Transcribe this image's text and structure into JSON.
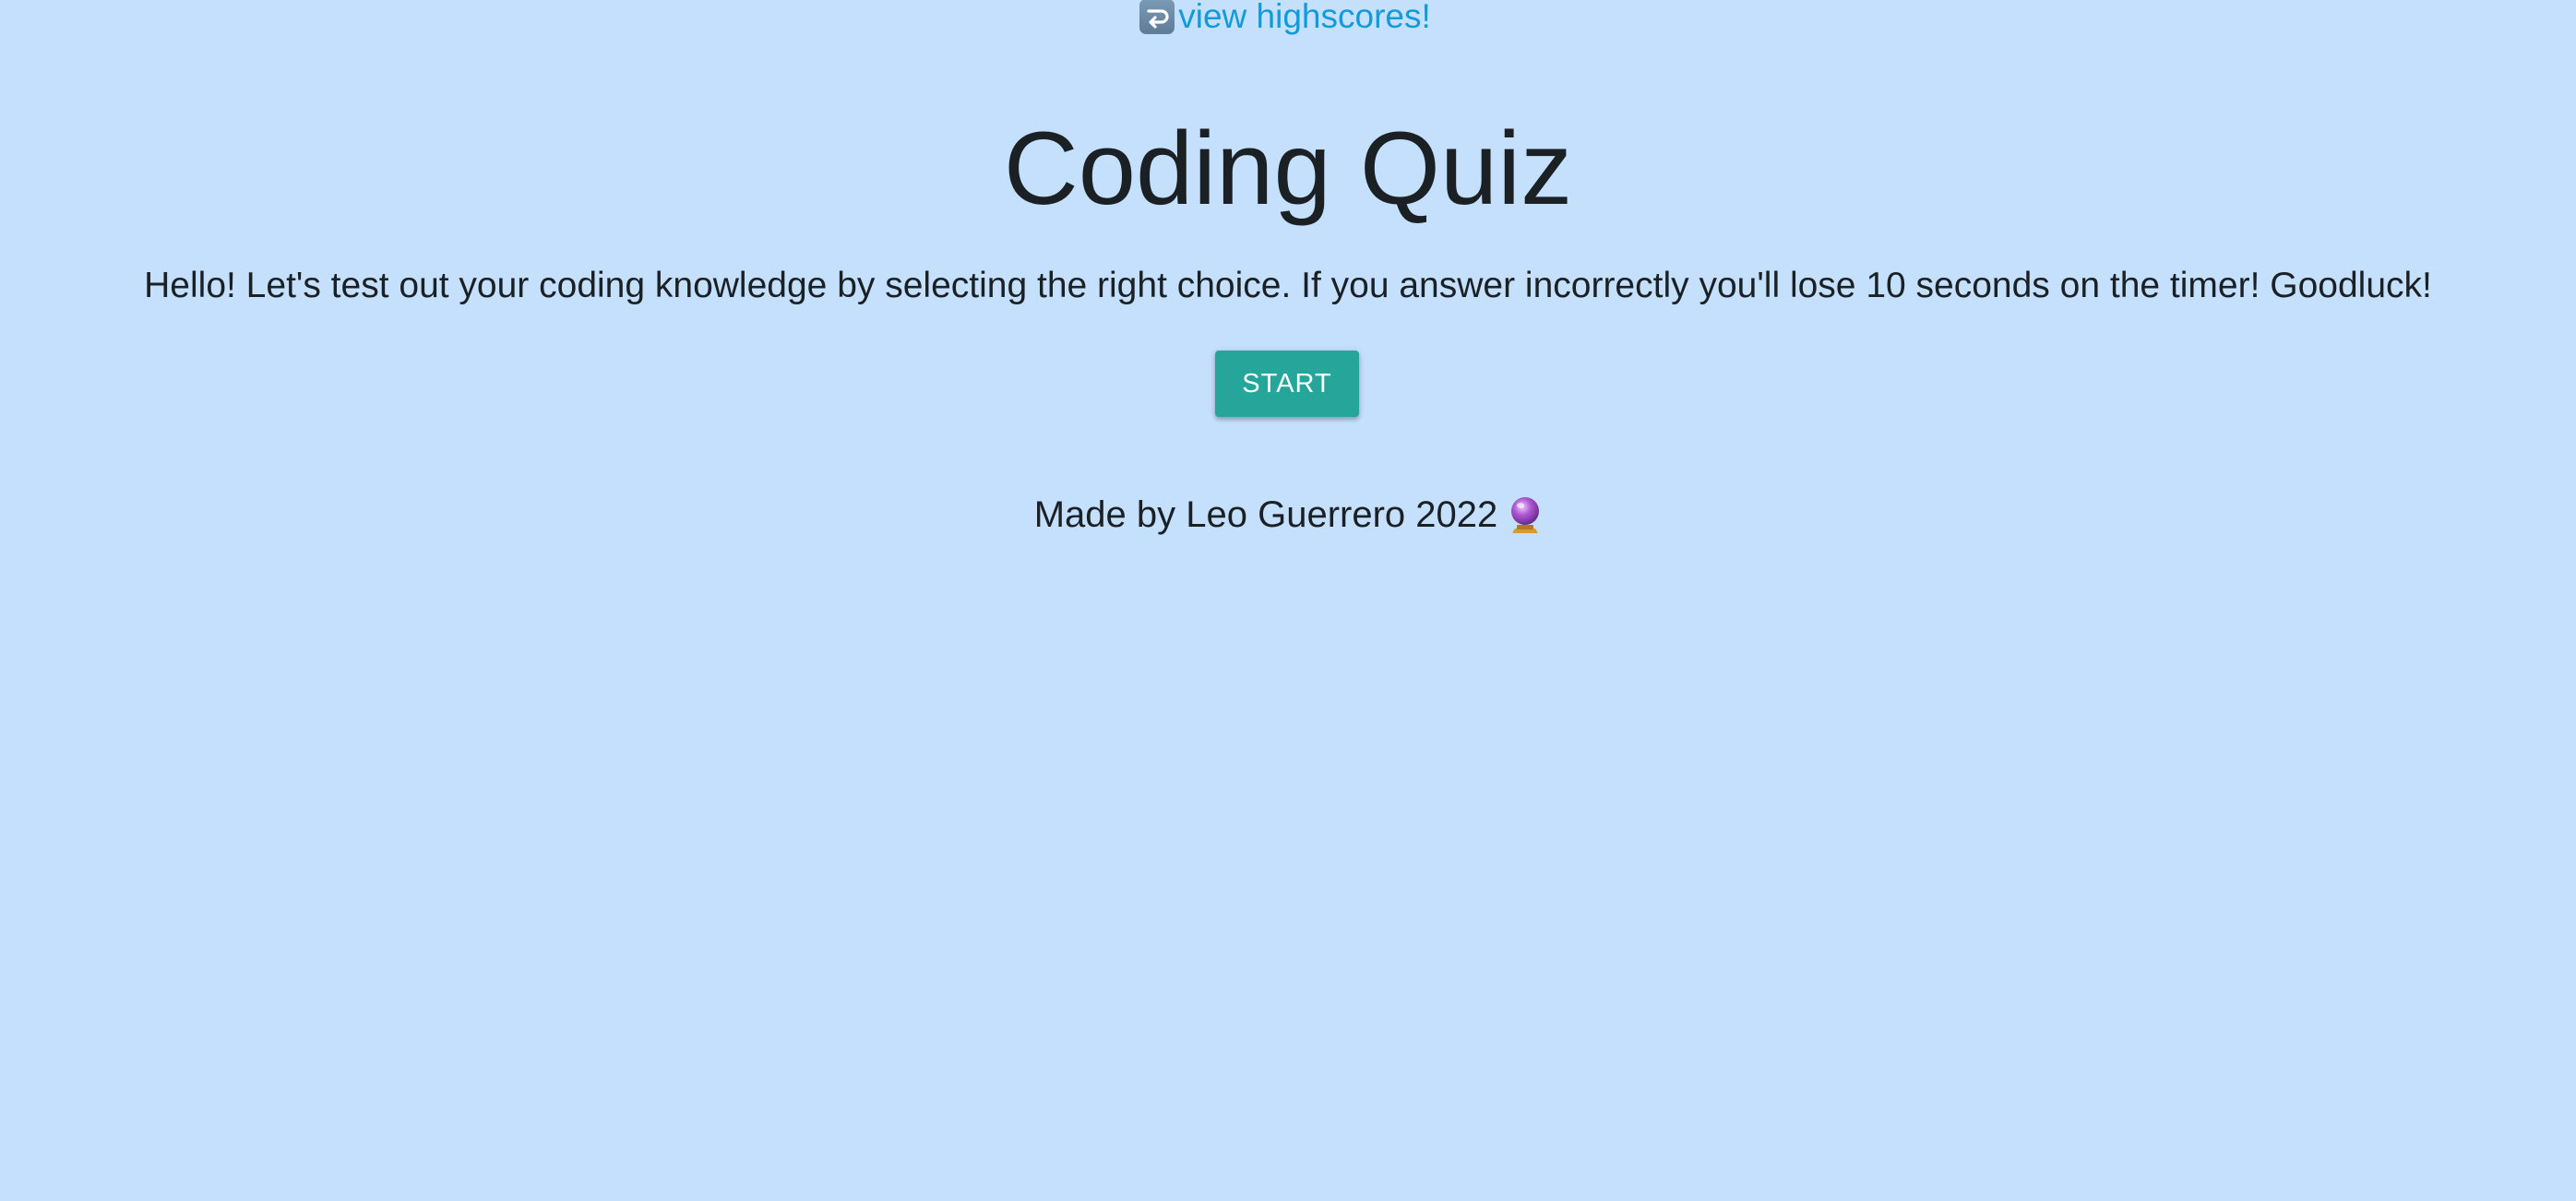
{
  "header": {
    "highscores_link": "view highscores!",
    "icon": "return-arrow-icon"
  },
  "main": {
    "title": "Coding Quiz",
    "intro": "Hello! Let's test out your coding knowledge by selecting the right choice. If you answer incorrectly you'll lose 10 seconds on the timer! Goodluck!",
    "start_label": "START"
  },
  "footer": {
    "text": "Made by Leo Guerrero 2022",
    "icon": "crystal-ball-icon"
  },
  "colors": {
    "background": "#c4e0fd",
    "link": "#129bd8",
    "button": "#26a69a",
    "text": "#1b2025"
  }
}
